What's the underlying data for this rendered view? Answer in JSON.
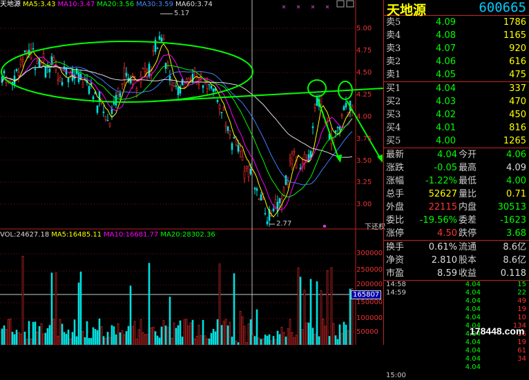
{
  "chart_header": {
    "name": "天地源",
    "ma5": "MA5:3.43",
    "ma10": "MA10:3.47",
    "ma20": "MA20:3.56",
    "ma30": "MA30:3.59",
    "ma60": "MA60:3.74"
  },
  "price_axis": [
    "5.00",
    "4.75",
    "4.50",
    "4.25",
    "4.00",
    "3.75",
    "3.50",
    "3.25",
    "3.00"
  ],
  "annotations": {
    "high": "5.17",
    "low": "2.77",
    "label_xiachuquan": "下还权"
  },
  "vol_header": {
    "vol": "VOL:24627.18",
    "ma5": "MA5:16485.11",
    "ma10": "MA10:16681.77",
    "ma20": "MA20:28302.36"
  },
  "vol_axis": [
    "300000",
    "250000",
    "200000",
    "150000",
    "100000",
    "50000"
  ],
  "vol_marker": "165807",
  "quote": {
    "name": "天地源",
    "code": "600665",
    "sells": [
      {
        "label": "卖5",
        "price": "4.09",
        "vol": "1786"
      },
      {
        "label": "卖4",
        "price": "4.08",
        "vol": "1165"
      },
      {
        "label": "卖3",
        "price": "4.07",
        "vol": "920"
      },
      {
        "label": "卖2",
        "price": "4.06",
        "vol": "616"
      },
      {
        "label": "卖1",
        "price": "4.05",
        "vol": "475"
      }
    ],
    "buys": [
      {
        "label": "买1",
        "price": "4.04",
        "vol": "337"
      },
      {
        "label": "买2",
        "price": "4.03",
        "vol": "470"
      },
      {
        "label": "买3",
        "price": "4.02",
        "vol": "450"
      },
      {
        "label": "买4",
        "price": "4.01",
        "vol": "816"
      },
      {
        "label": "买5",
        "price": "4.00",
        "vol": "1265"
      }
    ],
    "stats": [
      {
        "l1": "最新",
        "v1": "4.04",
        "c1": "green",
        "l2": "今开",
        "v2": "4.06",
        "c2": "green"
      },
      {
        "l1": "涨跌",
        "v1": "-0.05",
        "c1": "green",
        "l2": "最高",
        "v2": "4.09",
        "c2": "white"
      },
      {
        "l1": "涨幅",
        "v1": "-1.22%",
        "c1": "green",
        "l2": "最低",
        "v2": "4.00",
        "c2": "green"
      },
      {
        "l1": "总手",
        "v1": "52627",
        "c1": "yellow",
        "l2": "量比",
        "v2": "0.71",
        "c2": "yellow"
      },
      {
        "l1": "外盘",
        "v1": "22115",
        "c1": "red",
        "l2": "内盘",
        "v2": "30513",
        "c2": "green"
      },
      {
        "l1": "委比",
        "v1": "-19.56%",
        "c1": "green",
        "l2": "委差",
        "v2": "-1623",
        "c2": "green"
      },
      {
        "l1": "涨停",
        "v1": "4.50",
        "c1": "red",
        "l2": "跌停",
        "v2": "3.68",
        "c2": "green"
      }
    ],
    "stats2": [
      {
        "l1": "换手",
        "v1": "0.61%",
        "l2": "流通",
        "v2": "8.6亿"
      },
      {
        "l1": "净资",
        "v1": "2.810",
        "l2": "股本",
        "v2": "8.6亿"
      },
      {
        "l1": "市盈",
        "v1": "8.59",
        "l2": "收益",
        "v2": "0.118"
      }
    ],
    "ticks": [
      {
        "time": "14:58",
        "price": "4.04",
        "vol": "15",
        "color": "green"
      },
      {
        "time": "14:59",
        "price": "4.04",
        "vol": "22",
        "color": "green"
      },
      {
        "time": "",
        "price": "4.04",
        "vol": "49",
        "color": "red"
      },
      {
        "time": "",
        "price": "4.04",
        "vol": "19",
        "color": "red"
      },
      {
        "time": "",
        "price": "4.04",
        "vol": "10",
        "color": "red"
      },
      {
        "time": "",
        "price": "4.04",
        "vol": "134",
        "color": "red"
      },
      {
        "time": "",
        "price": "4.04",
        "vol": "16",
        "color": "red"
      },
      {
        "time": "",
        "price": "4.04",
        "vol": "19",
        "color": "red"
      },
      {
        "time": "",
        "price": "4.04",
        "vol": "61",
        "color": "red"
      },
      {
        "time": "",
        "price": "4.04",
        "vol": "34",
        "color": "red"
      },
      {
        "time": "",
        "price": "4.04",
        "vol": "",
        "color": "red"
      },
      {
        "time": "15:00",
        "price": "",
        "vol": "",
        "color": "red"
      }
    ]
  },
  "watermark": "178448.com",
  "colors": {
    "up": "#ff3030",
    "down": "#00e0e0",
    "border": "#c02020",
    "annot": "#00ff00"
  }
}
